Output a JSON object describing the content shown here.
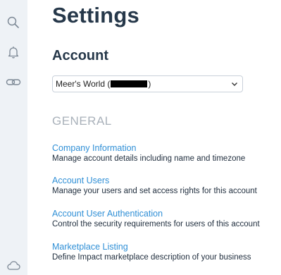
{
  "sidebar": {
    "icons": [
      "search-icon",
      "bell-icon",
      "link-icon",
      "cloud-icon"
    ]
  },
  "page": {
    "title": "Settings"
  },
  "account": {
    "heading": "Account",
    "selected_prefix": "Meer's World (",
    "selected_suffix": ")"
  },
  "general": {
    "heading": "GENERAL",
    "items": [
      {
        "label": "Company Information",
        "description": "Manage account details including name and timezone"
      },
      {
        "label": "Account Users",
        "description": "Manage your users and set access rights for this account"
      },
      {
        "label": "Account User Authentication",
        "description": "Control the security requirements for users of this account"
      },
      {
        "label": "Marketplace Listing",
        "description": "Define Impact marketplace description of your business"
      }
    ]
  },
  "colors": {
    "sidebar_bg": "#eef2f6",
    "heading": "#26384a",
    "link": "#2f8fd6",
    "muted_heading": "#a9b1ba"
  }
}
